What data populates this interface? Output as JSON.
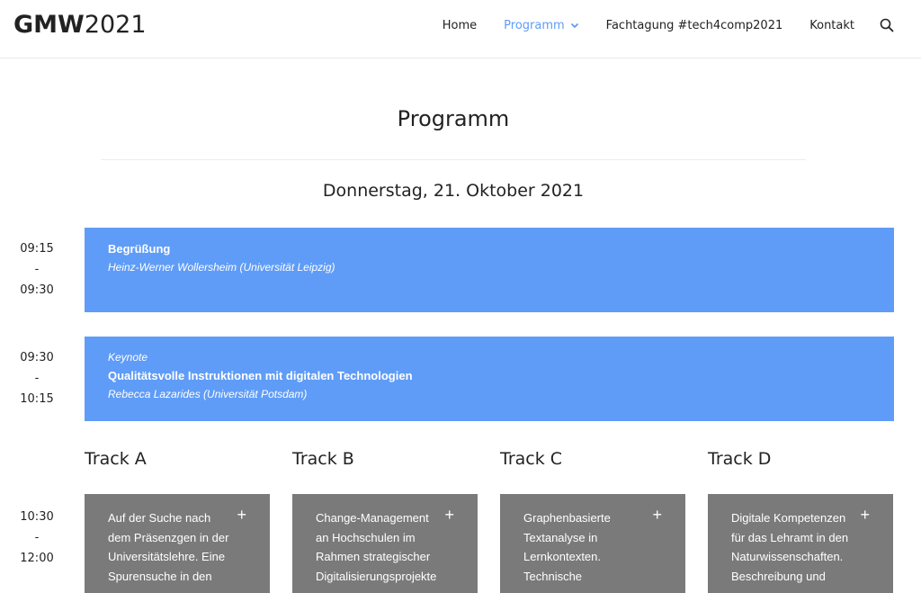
{
  "header": {
    "logo_bold": "GMW",
    "logo_light": "2021",
    "nav": [
      {
        "label": "Home"
      },
      {
        "label": "Programm"
      },
      {
        "label": "Fachtagung #tech4comp2021"
      },
      {
        "label": "Kontakt"
      }
    ]
  },
  "page": {
    "title": "Programm",
    "date": "Donnerstag, 21. Oktober 2021"
  },
  "sessions": [
    {
      "time_start": "09:15",
      "time_sep": "-",
      "time_end": "09:30",
      "title": "Begrüßung",
      "speaker": "Heinz-Werner Wollersheim (Universität Leipzig)"
    },
    {
      "time_start": "09:30",
      "time_sep": "-",
      "time_end": "10:15",
      "kicker": "Keynote",
      "title": "Qualitätsvolle Instruktionen mit digitalen Technologien",
      "speaker": "Rebecca Lazarides (Universität Potsdam)"
    }
  ],
  "tracks_time": {
    "time_start": "10:30",
    "time_sep": "-",
    "time_end": "12:00"
  },
  "tracks": [
    {
      "name": "Track A",
      "text": "Auf der Suche nach\ndem Präsenzgen in der\nUniversitätslehre. Eine\nSpurensuche in den",
      "plus": "+"
    },
    {
      "name": "Track B",
      "text": "Change-Management\nan Hochschulen im\nRahmen strategischer\nDigitalisierungsprojekte",
      "plus": "+"
    },
    {
      "name": "Track C",
      "text": "Graphenbasierte\nTextanalyse in\nLernkontexten.\nTechnische",
      "plus": "+"
    },
    {
      "name": "Track D",
      "text": "Digitale Kompetenzen\nfür das Lehramt in den\nNaturwissenschaften.\nBeschreibung und",
      "plus": "+"
    }
  ],
  "colors": {
    "accent": "#5f9cf7",
    "card": "#7a7a7a"
  }
}
